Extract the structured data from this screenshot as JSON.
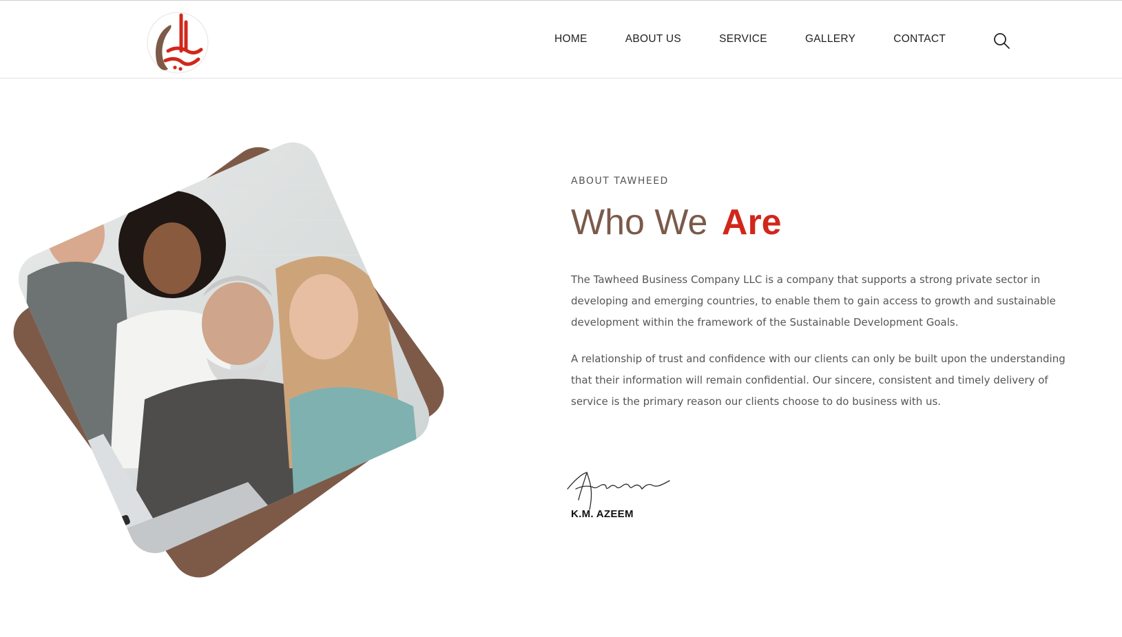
{
  "brand": {
    "logo_icon": "tawheed-logo-icon",
    "accent_color": "#d1271b",
    "brown_color": "#7d5a48"
  },
  "nav": {
    "items": [
      "HOME",
      "ABOUT US",
      "SERVICE",
      "GALLERY",
      "CONTACT"
    ],
    "search_icon": "search-icon"
  },
  "about": {
    "kicker": "ABOUT TAWHEED",
    "title_light": "Who We",
    "title_bold": "Are",
    "paragraphs": [
      "The Tawheed Business Company LLC is a company that supports a strong private sector in developing and emerging countries, to enable them to gain access to growth and sustainable development within the framework of the Sustainable Development Goals.",
      "A relationship of trust and confidence with our clients can only be built upon the understanding that their information will remain confidential. Our sincere, consistent and timely delivery of service is the primary reason our clients choose to do business with us."
    ],
    "signature_name": "K.M. AZEEM"
  },
  "image": {
    "subject": "team-working-at-laptop-photo"
  }
}
